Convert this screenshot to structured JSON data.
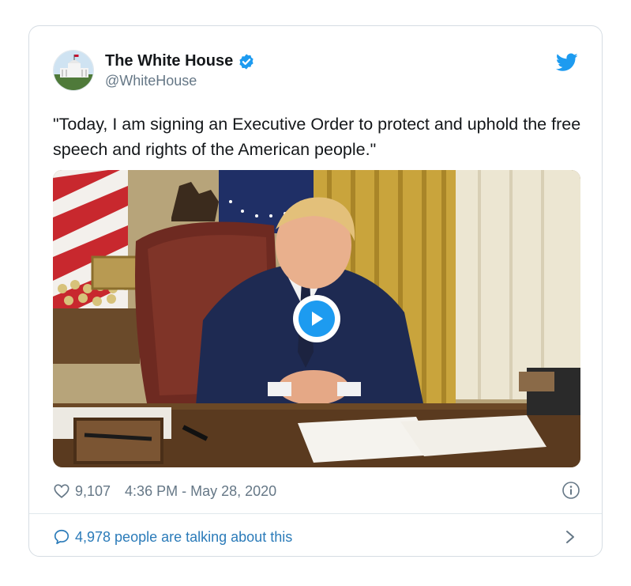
{
  "author": {
    "display_name": "The White House",
    "handle": "@WhiteHouse",
    "verified": true
  },
  "tweet": {
    "text": "\"Today, I am signing an Executive Order to protect and uphold the free speech and rights of the American people.\""
  },
  "media": {
    "type": "video",
    "play_icon": "play-icon"
  },
  "meta": {
    "like_count": "9,107",
    "timestamp": "4:36 PM - May 28, 2020"
  },
  "conversation": {
    "label": "4,978 people are talking about this"
  },
  "colors": {
    "accent": "#1d9bf0",
    "link": "#2b7bb9",
    "muted": "#657786",
    "border": "#e1e8ed"
  },
  "icons": [
    "twitter-logo-icon",
    "verified-badge-icon",
    "heart-icon",
    "info-icon",
    "reply-icon",
    "chevron-right-icon",
    "play-icon"
  ]
}
